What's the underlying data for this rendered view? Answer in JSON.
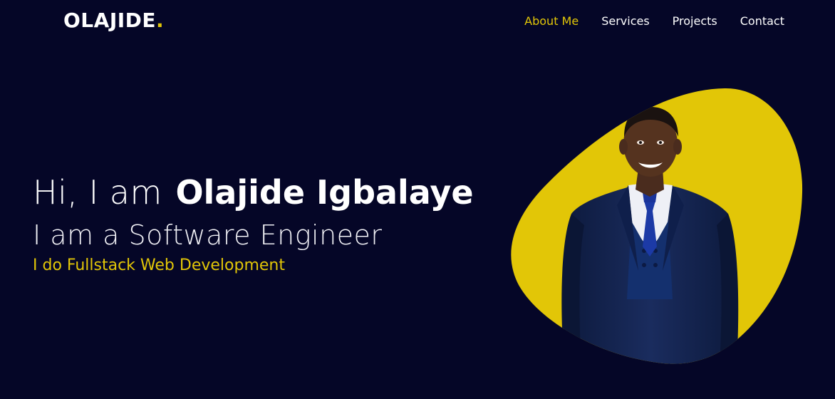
{
  "header": {
    "logo_text": "OLAJIDE",
    "logo_dot": "."
  },
  "nav": {
    "items": [
      {
        "label": "About Me",
        "active": true
      },
      {
        "label": "Services",
        "active": false
      },
      {
        "label": "Projects",
        "active": false
      },
      {
        "label": "Contact",
        "active": false
      }
    ]
  },
  "hero": {
    "greeting_prefix": "Hi, I am",
    "name": "Olajide Igbalaye",
    "role": "I am a Software Engineer",
    "tagline": "I do Fullstack Web Development"
  },
  "colors": {
    "background": "#050627",
    "accent": "#e2c607",
    "text": "#ffffff",
    "suit": "#13234f",
    "tie": "#1c3aa6"
  }
}
